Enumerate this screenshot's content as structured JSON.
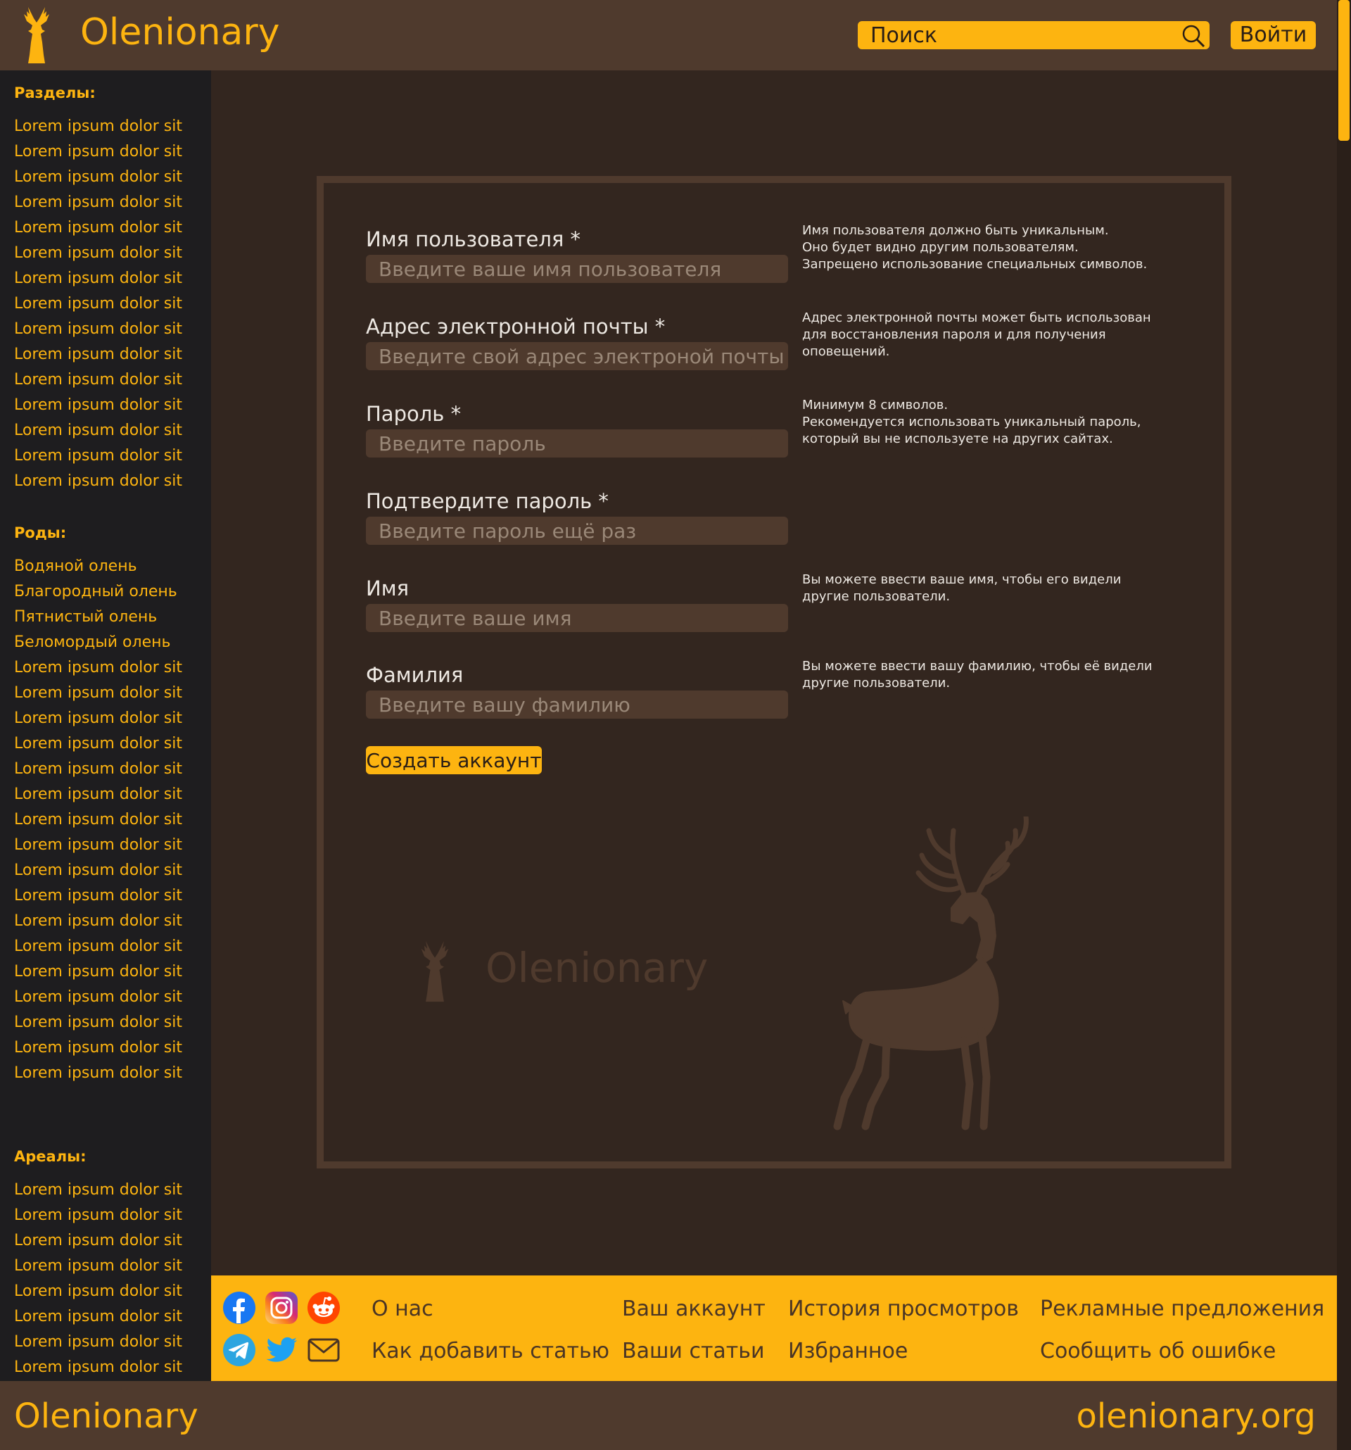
{
  "header": {
    "site_title": "Olenionary",
    "search_placeholder": "Поиск",
    "login_label": "Войти"
  },
  "sidebar": {
    "sections": {
      "heading": "Разделы:",
      "items": [
        "Lorem ipsum dolor sit",
        "Lorem ipsum dolor sit",
        "Lorem ipsum dolor sit",
        "Lorem ipsum dolor sit",
        "Lorem ipsum dolor sit",
        "Lorem ipsum dolor sit",
        "Lorem ipsum dolor sit",
        "Lorem ipsum dolor sit",
        "Lorem ipsum dolor sit",
        "Lorem ipsum dolor sit",
        "Lorem ipsum dolor sit",
        "Lorem ipsum dolor sit",
        "Lorem ipsum dolor sit",
        "Lorem ipsum dolor sit",
        "Lorem ipsum dolor sit"
      ]
    },
    "genera": {
      "heading": "Роды:",
      "items": [
        "Водяной олень",
        "Благородный олень",
        "Пятнистый олень",
        "Беломордый олень",
        "Lorem ipsum dolor sit",
        "Lorem ipsum dolor sit",
        "Lorem ipsum dolor sit",
        "Lorem ipsum dolor sit",
        "Lorem ipsum dolor sit",
        "Lorem ipsum dolor sit",
        "Lorem ipsum dolor sit",
        "Lorem ipsum dolor sit",
        "Lorem ipsum dolor sit",
        "Lorem ipsum dolor sit",
        "Lorem ipsum dolor sit",
        "Lorem ipsum dolor sit",
        "Lorem ipsum dolor sit",
        "Lorem ipsum dolor sit",
        "Lorem ipsum dolor sit",
        "Lorem ipsum dolor sit",
        "Lorem ipsum dolor sit"
      ]
    },
    "ranges": {
      "heading": "Ареалы:",
      "items": [
        "Lorem ipsum dolor sit",
        "Lorem ipsum dolor sit",
        "Lorem ipsum dolor sit",
        "Lorem ipsum dolor sit",
        "Lorem ipsum dolor sit",
        "Lorem ipsum dolor sit",
        "Lorem ipsum dolor sit",
        "Lorem ipsum dolor sit"
      ]
    }
  },
  "form": {
    "username": {
      "label": "Имя пользователя *",
      "placeholder": "Введите ваше имя пользователя",
      "hint": "Имя пользователя должно быть уникальным.\nОно будет видно другим пользователям.\nЗапрещено использование специальных символов."
    },
    "email": {
      "label": "Адрес электронной почты *",
      "placeholder": "Введите свой адрес электроной почты",
      "hint": "Адрес электронной почты может быть использован\nдля восстановления пароля и для получения\nоповещений."
    },
    "password": {
      "label": "Пароль *",
      "placeholder": "Введите пароль",
      "hint": "Минимум 8 символов.\nРекомендуется использовать уникальный пароль,\nкоторый вы не используете на других сайтах."
    },
    "confirm_password": {
      "label": "Подтвердите пароль *",
      "placeholder": "Введите пароль ещё раз"
    },
    "first_name": {
      "label": "Имя",
      "placeholder": "Введите ваше имя",
      "hint": "Вы можете ввести ваше имя, чтобы его видели\nдругие пользователи."
    },
    "last_name": {
      "label": "Фамилия",
      "placeholder": "Введите вашу фамилию",
      "hint": "Вы можете ввести вашу фамилию, чтобы её видели\nдругие пользователи."
    },
    "submit_label": "Создать аккаунт",
    "watermark_text": "Olenionary"
  },
  "footer": {
    "social_icons": [
      "facebook-icon",
      "instagram-icon",
      "reddit-icon",
      "telegram-icon",
      "twitter-icon",
      "mail-icon"
    ],
    "links": {
      "about": "О нас",
      "how_to_add": "Как добавить статью",
      "your_account": "Ваш аккаунт",
      "your_articles": "Ваши статьи",
      "history": "История просмотров",
      "favorites": "Избранное",
      "ads": "Рекламные предложения",
      "report_error": "Сообщить об ошибке"
    },
    "brand": "Olenionary",
    "domain": "olenionary.org"
  },
  "colors": {
    "accent": "#fdb410",
    "header_bg": "#4f3a2d",
    "page_bg": "#33261f",
    "sidebar_bg": "#1e1d1f"
  }
}
